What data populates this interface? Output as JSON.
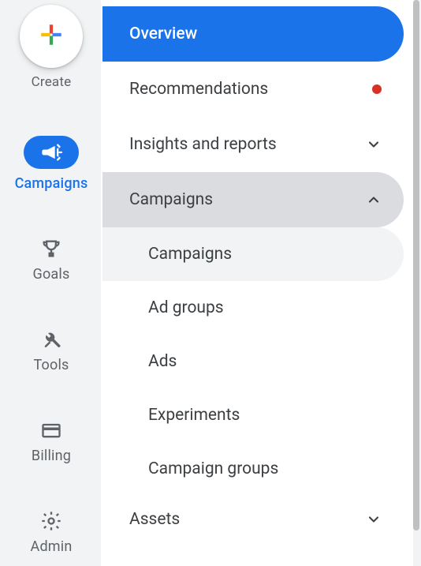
{
  "rail": {
    "create": "Create",
    "items": [
      {
        "id": "campaigns",
        "label": "Campaigns",
        "active": true
      },
      {
        "id": "goals",
        "label": "Goals"
      },
      {
        "id": "tools",
        "label": "Tools"
      },
      {
        "id": "billing",
        "label": "Billing"
      },
      {
        "id": "admin",
        "label": "Admin"
      }
    ]
  },
  "nav": {
    "overview": "Overview",
    "recommendations": "Recommendations",
    "insights": "Insights and reports",
    "campaigns_hdr": "Campaigns",
    "sub": {
      "campaigns": "Campaigns",
      "ad_groups": "Ad groups",
      "ads": "Ads",
      "experiments": "Experiments",
      "campaign_groups": "Campaign groups"
    },
    "assets": "Assets"
  },
  "colors": {
    "primary": "#1a73e8",
    "grey_bg": "#f1f3f4",
    "header_grey": "#dadce0",
    "text": "#3c4043",
    "muted": "#5f6368",
    "alert": "#d93025"
  }
}
